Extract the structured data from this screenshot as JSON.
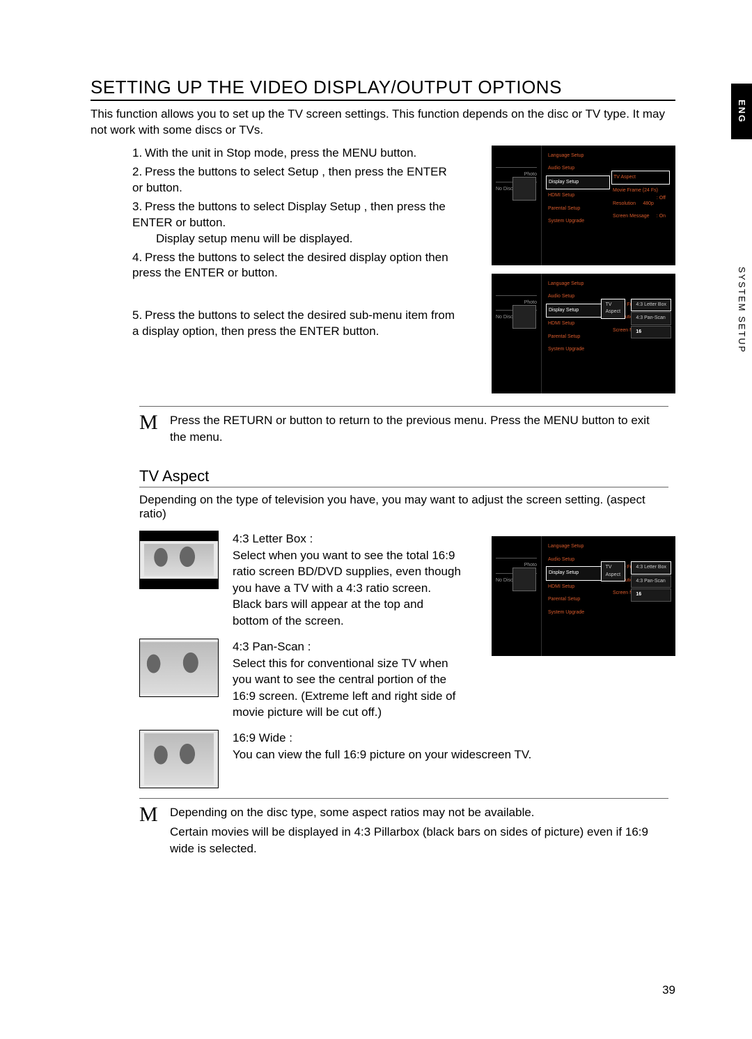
{
  "lang_tab": "ENG",
  "section_tab": "SYSTEM SETUP",
  "title": "SETTING UP THE VIDEO DISPLAY/OUTPUT OPTIONS",
  "intro": "This function allows you to set up the TV screen settings. This function depends on the disc or TV type. It may not work with some discs or TVs.",
  "steps": {
    "s1": "With the unit in Stop mode, press the MENU button.",
    "s2": "Press the         buttons to select Setup , then press the ENTER or        button.",
    "s3": "Press the         buttons to select Display Setup , then press the ENTER or        button.",
    "s3b": "Display setup menu will be displayed.",
    "s4": "Press the         buttons to select the desired display option then press the ENTER or        button.",
    "s5": "Press the         buttons to select the desired sub-menu item from a display option, then press the ENTER button."
  },
  "osd": {
    "side_photo": "Photo",
    "side_nodisc": "No Disc",
    "menu": {
      "a": "Language Setup",
      "b": "Audio Setup",
      "c": "Display Setup",
      "d": "HDMI Setup",
      "e": "Parental Setup",
      "f": "System Upgrade"
    },
    "opts": {
      "r1_l": "TV Aspect",
      "r1_v": "",
      "r2_l": "Movie Frame (24 Fs)",
      "r2_v": ": Off",
      "r3_l": "Resolution",
      "r3_v": "480p",
      "r4_l": "Screen Message",
      "r4_v": ": On"
    },
    "popup": {
      "label": "TV Aspect",
      "o1": "4:3  Letter Box",
      "o2": "4:3  Pan-Scan",
      "o3_prefix": "16"
    }
  },
  "note1": "Press the RETURN or       button to return to the previous menu. Press the MENU button to exit the menu.",
  "tv_heading": "TV Aspect",
  "tv_intro": "Depending on the type of television you have, you may want to adjust the screen setting. (aspect ratio)",
  "aspect": {
    "a_t": "4:3 Letter Box :",
    "a_d": "Select when you want to see the total 16:9 ratio screen BD/DVD supplies, even though you have a TV with a 4:3 ratio screen. Black bars will appear at the top and bottom of the screen.",
    "b_t": "4:3 Pan-Scan :",
    "b_d": "Select this for conventional size TV when you want to see the central portion of the 16:9 screen. (Extreme left and right side of movie picture will be cut off.)",
    "c_t": "16:9 Wide :",
    "c_d": "You can view the full 16:9 picture on your widescreen TV."
  },
  "note2a": "Depending on the disc type, some aspect ratios may not be available.",
  "note2b": "Certain movies will be displayed in 4:3 Pillarbox (black bars on sides of picture) even if 16:9 wide is selected.",
  "page_number": "39"
}
